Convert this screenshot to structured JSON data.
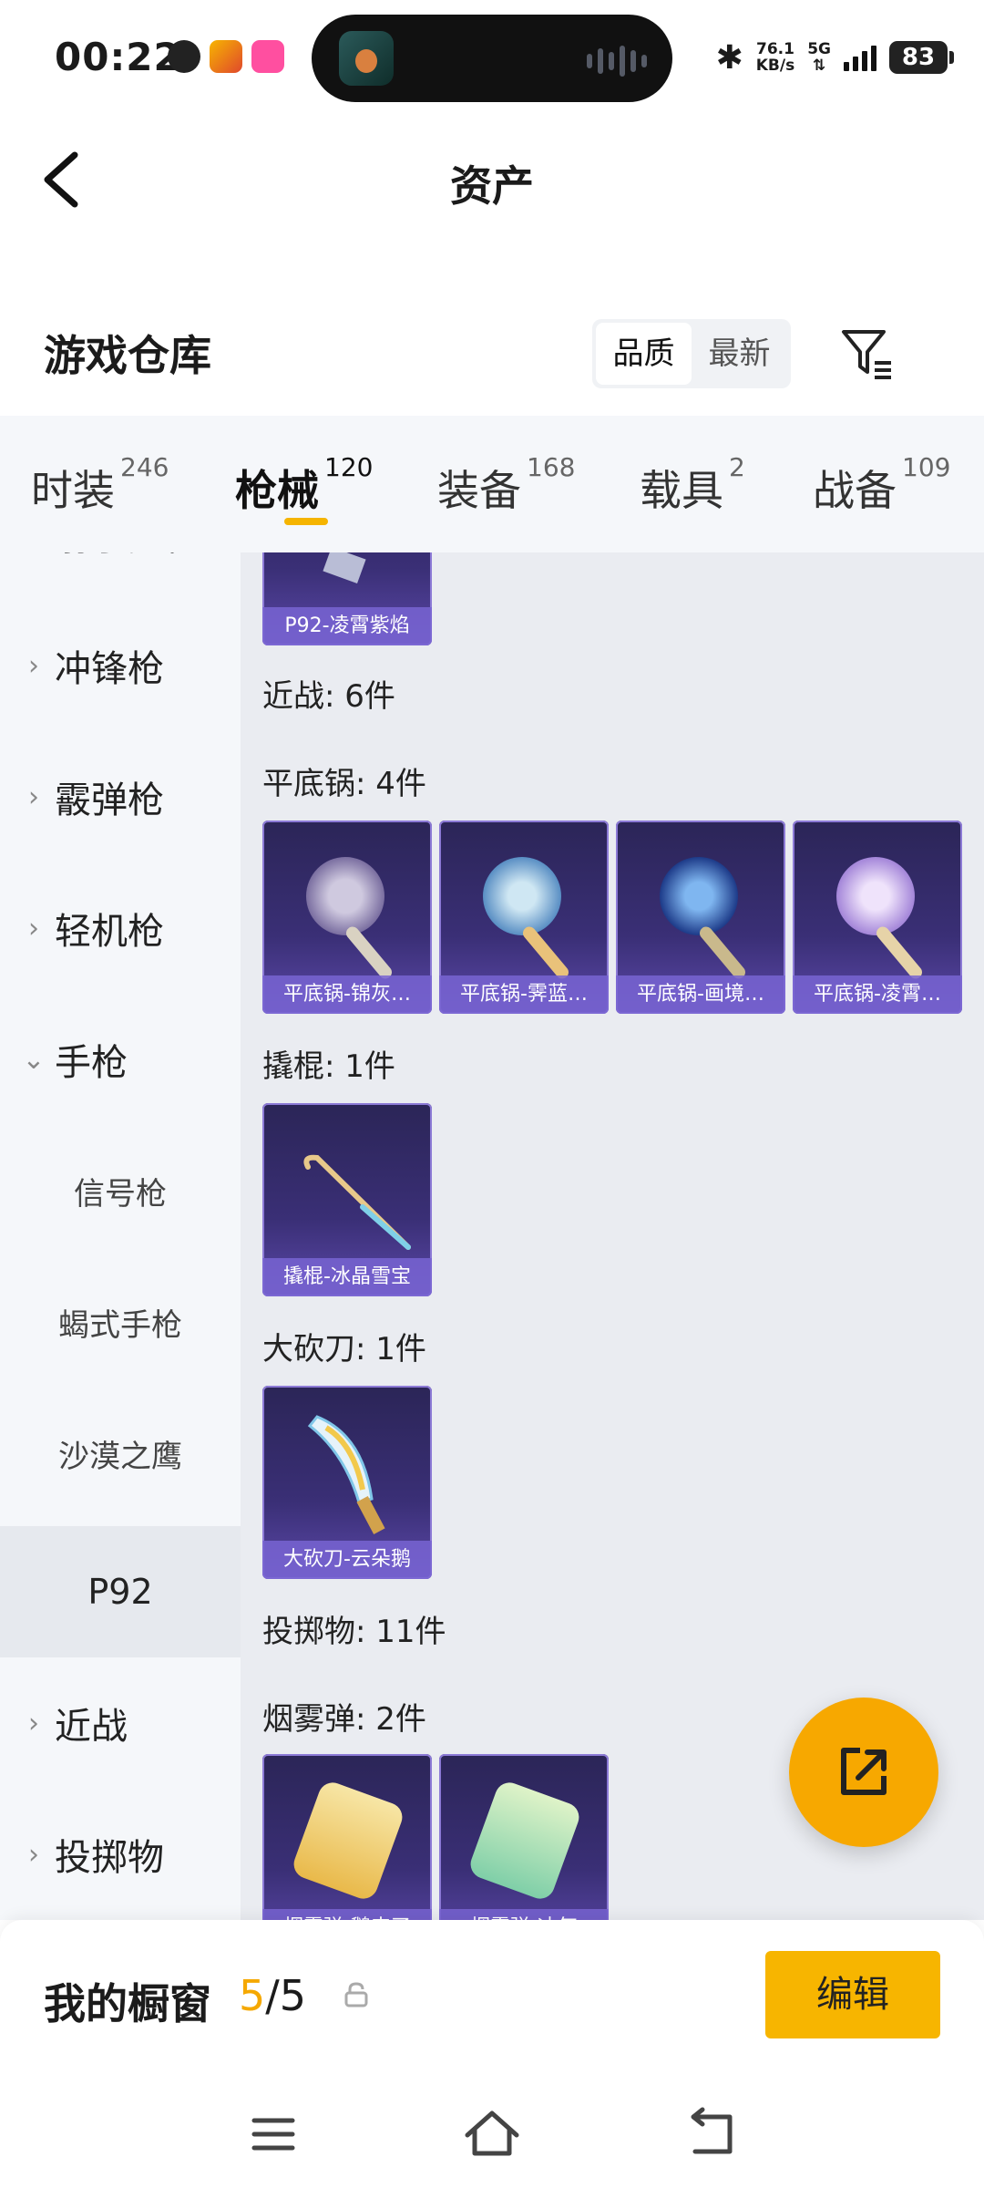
{
  "status_bar": {
    "time": "00:22",
    "net_speed": "76.1",
    "net_unit": "KB/s",
    "network": "5G",
    "battery": "83"
  },
  "header": {
    "title": "资产"
  },
  "warehouse": {
    "title": "游戏仓库",
    "sort_options": [
      "品质",
      "最新"
    ],
    "active_sort": "品质"
  },
  "tabs": [
    {
      "label": "时装",
      "count": "246"
    },
    {
      "label": "枪械",
      "count": "120"
    },
    {
      "label": "装备",
      "count": "168"
    },
    {
      "label": "载具",
      "count": "2"
    },
    {
      "label": "战备",
      "count": "109"
    }
  ],
  "active_tab": "枪械",
  "sidebar": {
    "partial_top": "射手步枪",
    "items": [
      {
        "label": "冲锋枪",
        "type": "group"
      },
      {
        "label": "霰弹枪",
        "type": "group"
      },
      {
        "label": "轻机枪",
        "type": "group"
      },
      {
        "label": "手枪",
        "type": "group-open"
      },
      {
        "label": "信号枪",
        "type": "sub"
      },
      {
        "label": "蝎式手枪",
        "type": "sub"
      },
      {
        "label": "沙漠之鹰",
        "type": "sub"
      },
      {
        "label": "P92",
        "type": "active"
      },
      {
        "label": "近战",
        "type": "group"
      },
      {
        "label": "投掷物",
        "type": "group"
      }
    ]
  },
  "content": {
    "top_card": "P92-凌霄紫焰",
    "melee_header": "近战: 6件",
    "pan_header": "平底锅: 4件",
    "pans": [
      "平底锅-锦灰…",
      "平底锅-霁蓝…",
      "平底锅-画境…",
      "平底锅-凌霄…"
    ],
    "crowbar_header": "撬棍: 1件",
    "crowbar": "撬棍-冰晶雪宝",
    "machete_header": "大砍刀: 1件",
    "machete": "大砍刀-云朵鹅",
    "throwable_header": "投掷物: 11件",
    "smoke_header": "烟雾弹: 2件",
    "smokes": [
      "烟雾弹-鹅来了",
      "烟雾弹-冰气"
    ]
  },
  "showcase": {
    "title": "我的橱窗",
    "current": "5",
    "total": "/5",
    "edit_label": "编辑"
  },
  "icons": {
    "back": "back-arrow-icon",
    "filter": "filter-icon",
    "fab": "share-export-icon",
    "lock": "lock-icon",
    "nav": [
      "menu-icon",
      "home-icon",
      "back-icon"
    ]
  },
  "colors": {
    "accent": "#f7b500",
    "card_bg": "#3a2f76",
    "card_label": "#7864d2"
  }
}
